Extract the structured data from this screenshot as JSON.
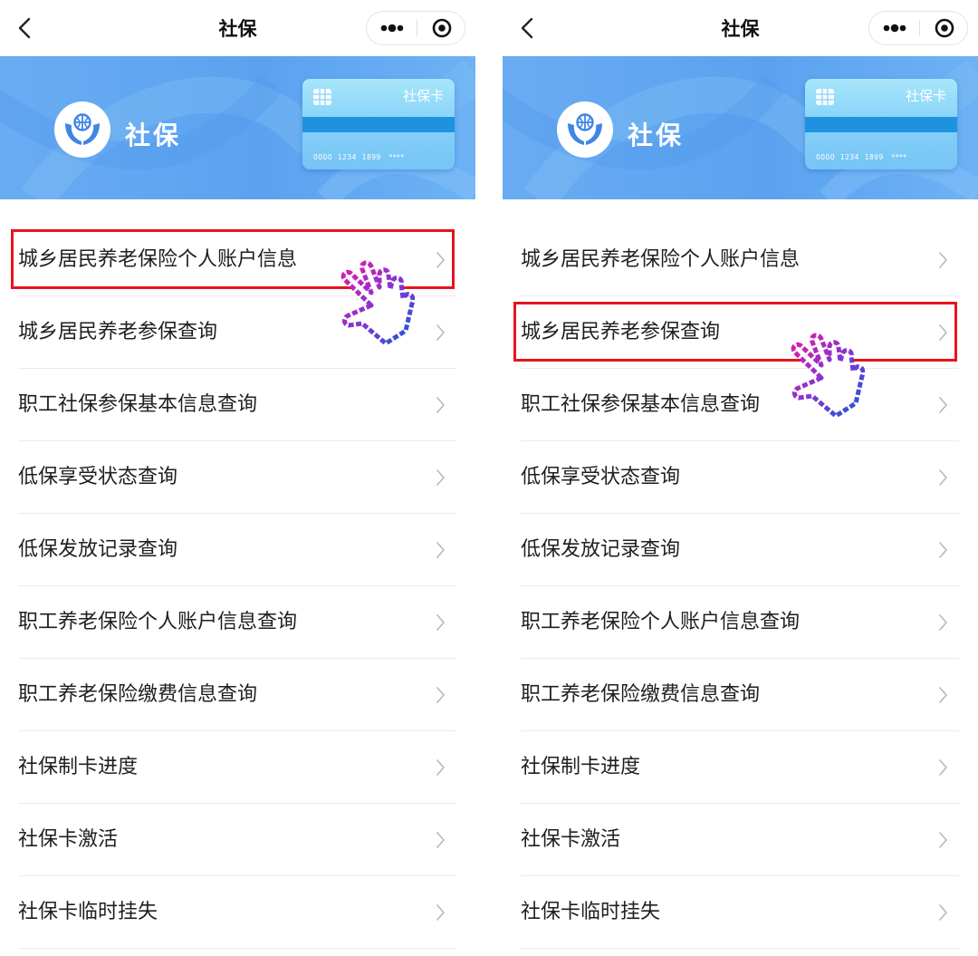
{
  "panels": [
    {
      "nav": {
        "title": "社保"
      },
      "banner": {
        "title": "社保",
        "card_label": "社保卡",
        "card_number": "0000  1234  1899   ****"
      },
      "menu": [
        {
          "label": "城乡居民养老保险个人账户信息"
        },
        {
          "label": "城乡居民养老参保查询"
        },
        {
          "label": "职工社保参保基本信息查询"
        },
        {
          "label": "低保享受状态查询"
        },
        {
          "label": "低保发放记录查询"
        },
        {
          "label": "职工养老保险个人账户信息查询"
        },
        {
          "label": "职工养老保险缴费信息查询"
        },
        {
          "label": "社保制卡进度"
        },
        {
          "label": "社保卡激活"
        },
        {
          "label": "社保卡临时挂失"
        }
      ],
      "highlighted_index": 0
    },
    {
      "nav": {
        "title": "社保"
      },
      "banner": {
        "title": "社保",
        "card_label": "社保卡",
        "card_number": "0000  1234  1899   ****"
      },
      "menu": [
        {
          "label": "城乡居民养老保险个人账户信息"
        },
        {
          "label": "城乡居民养老参保查询"
        },
        {
          "label": "职工社保参保基本信息查询"
        },
        {
          "label": "低保享受状态查询"
        },
        {
          "label": "低保发放记录查询"
        },
        {
          "label": "职工养老保险个人账户信息查询"
        },
        {
          "label": "职工养老保险缴费信息查询"
        },
        {
          "label": "社保制卡进度"
        },
        {
          "label": "社保卡激活"
        },
        {
          "label": "社保卡临时挂失"
        }
      ],
      "highlighted_index": 1
    }
  ],
  "icons": {
    "back": "chevron-left-icon",
    "more": "more-dots-icon",
    "close": "target-circle-icon",
    "logo": "hands-globe-icon",
    "chip": "card-chip-icon",
    "row_arrow": "chevron-right-icon",
    "pointer": "pointing-hand-icon"
  },
  "colors": {
    "banner": "#5aa2f0",
    "highlight": "#e7141c",
    "card_stripe": "#1e92de",
    "logo_blue": "#3f86e6"
  }
}
